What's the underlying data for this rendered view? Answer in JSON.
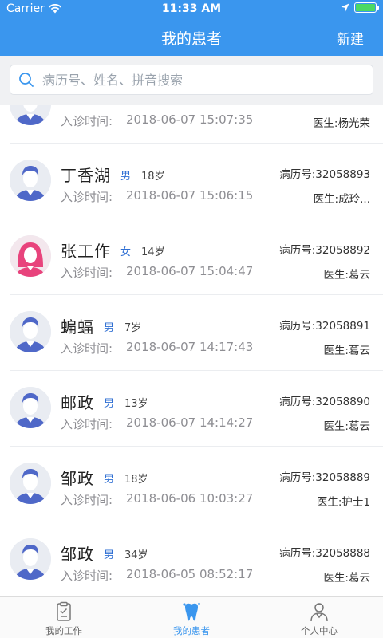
{
  "status_bar": {
    "carrier": "Carrier",
    "time": "11:33 AM"
  },
  "nav": {
    "title": "我的患者",
    "action": "新建"
  },
  "search": {
    "placeholder": "病历号、姓名、拼音搜索"
  },
  "labels": {
    "visit_time": "入诊时间:"
  },
  "patients": [
    {
      "name": "",
      "gender": "",
      "age": "",
      "visit_time": "2018-06-07 15:07:35",
      "record": "",
      "doctor": "医生:杨光荣",
      "avatar": "male"
    },
    {
      "name": "丁香湖",
      "gender": "男",
      "age": "18岁",
      "visit_time": "2018-06-07 15:06:15",
      "record": "病历号:32058893",
      "doctor": "医生:成玲...",
      "avatar": "male"
    },
    {
      "name": "张工作",
      "gender": "女",
      "age": "14岁",
      "visit_time": "2018-06-07 15:04:47",
      "record": "病历号:32058892",
      "doctor": "医生:葛云",
      "avatar": "female"
    },
    {
      "name": "蝙蝠",
      "gender": "男",
      "age": "7岁",
      "visit_time": "2018-06-07 14:17:43",
      "record": "病历号:32058891",
      "doctor": "医生:葛云",
      "avatar": "male"
    },
    {
      "name": "邮政",
      "gender": "男",
      "age": "13岁",
      "visit_time": "2018-06-07 14:14:27",
      "record": "病历号:32058890",
      "doctor": "医生:葛云",
      "avatar": "male"
    },
    {
      "name": "邹政",
      "gender": "男",
      "age": "18岁",
      "visit_time": "2018-06-06 10:03:27",
      "record": "病历号:32058889",
      "doctor": "医生:护士1",
      "avatar": "male"
    },
    {
      "name": "邹政",
      "gender": "男",
      "age": "34岁",
      "visit_time": "2018-06-05 08:52:17",
      "record": "病历号:32058888",
      "doctor": "医生:葛云",
      "avatar": "male"
    }
  ],
  "tabs": [
    {
      "label": "我的工作",
      "icon": "clipboard-icon"
    },
    {
      "label": "我的患者",
      "icon": "tooth-icon"
    },
    {
      "label": "个人中心",
      "icon": "doctor-icon"
    }
  ],
  "colors": {
    "primary": "#3a96ee",
    "male_avatar": "#4f68c8",
    "female_avatar": "#e8437c"
  }
}
